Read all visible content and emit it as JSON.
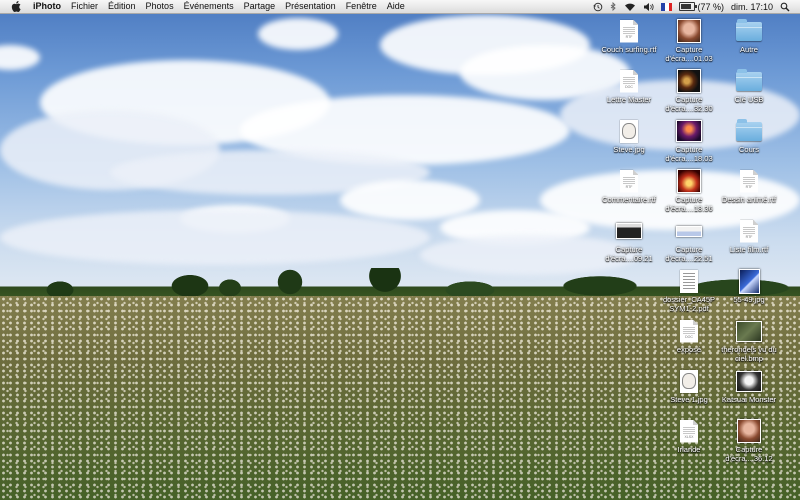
{
  "menubar": {
    "app_name": "iPhoto",
    "menus": [
      "Fichier",
      "Édition",
      "Photos",
      "Événements",
      "Partage",
      "Présentation",
      "Fenêtre",
      "Aide"
    ],
    "status": {
      "battery_text": "(77 %)",
      "battery_fraction": 0.77,
      "clock": "dim. 17:10",
      "icons": [
        "time-machine-icon",
        "bluetooth-icon",
        "wifi-icon",
        "volume-icon",
        "french-flag-icon",
        "battery-icon",
        "search-icon"
      ]
    }
  },
  "desktop": {
    "icons": [
      {
        "label": "Couch surfing.rtf",
        "kind": "rtf"
      },
      {
        "label": "Capture d'écra....01.03",
        "kind": "screenshot-portrait"
      },
      {
        "label": "Autre",
        "kind": "folder"
      },
      {
        "label": "Lettre Master",
        "kind": "doc"
      },
      {
        "label": "Capture d'écra....32.30",
        "kind": "screenshot-dark"
      },
      {
        "label": "Clé USB",
        "kind": "folder"
      },
      {
        "label": "Steve.jpg",
        "kind": "jpg"
      },
      {
        "label": "Capture d'écra....18.03",
        "kind": "screenshot-concert"
      },
      {
        "label": "Cours",
        "kind": "folder"
      },
      {
        "label": "Commentaire.rtf",
        "kind": "rtf"
      },
      {
        "label": "Capture d'écra....18.36",
        "kind": "screenshot-stage"
      },
      {
        "label": "Dessin animé.rtf",
        "kind": "rtf"
      },
      {
        "label": "Capture d'écra....09.21",
        "kind": "screenshot-window"
      },
      {
        "label": "Capture d'écra....22.51",
        "kind": "screenshot-bar"
      },
      {
        "label": "Liste film.rtf",
        "kind": "rtf"
      },
      {
        "label": "dossier_CA45P SYM1-2.pdf",
        "kind": "pdf"
      },
      {
        "label": "55-49.jpg",
        "kind": "jpg-blue"
      },
      {
        "label": "exposé",
        "kind": "doc"
      },
      {
        "label": "therondels vu du ciel.bmp",
        "kind": "bmp"
      },
      {
        "label": "Steve 1.jpg",
        "kind": "jpg"
      },
      {
        "label": "Katsuai Monster",
        "kind": "jpg-monster"
      },
      {
        "label": "Irlande",
        "kind": "xlsx"
      },
      {
        "label": "Capture d'écra....36.12",
        "kind": "screenshot-portrait"
      }
    ],
    "doc_tags": {
      "rtf": "RTF",
      "doc": "DOC",
      "xlsx": "XLSX"
    }
  }
}
